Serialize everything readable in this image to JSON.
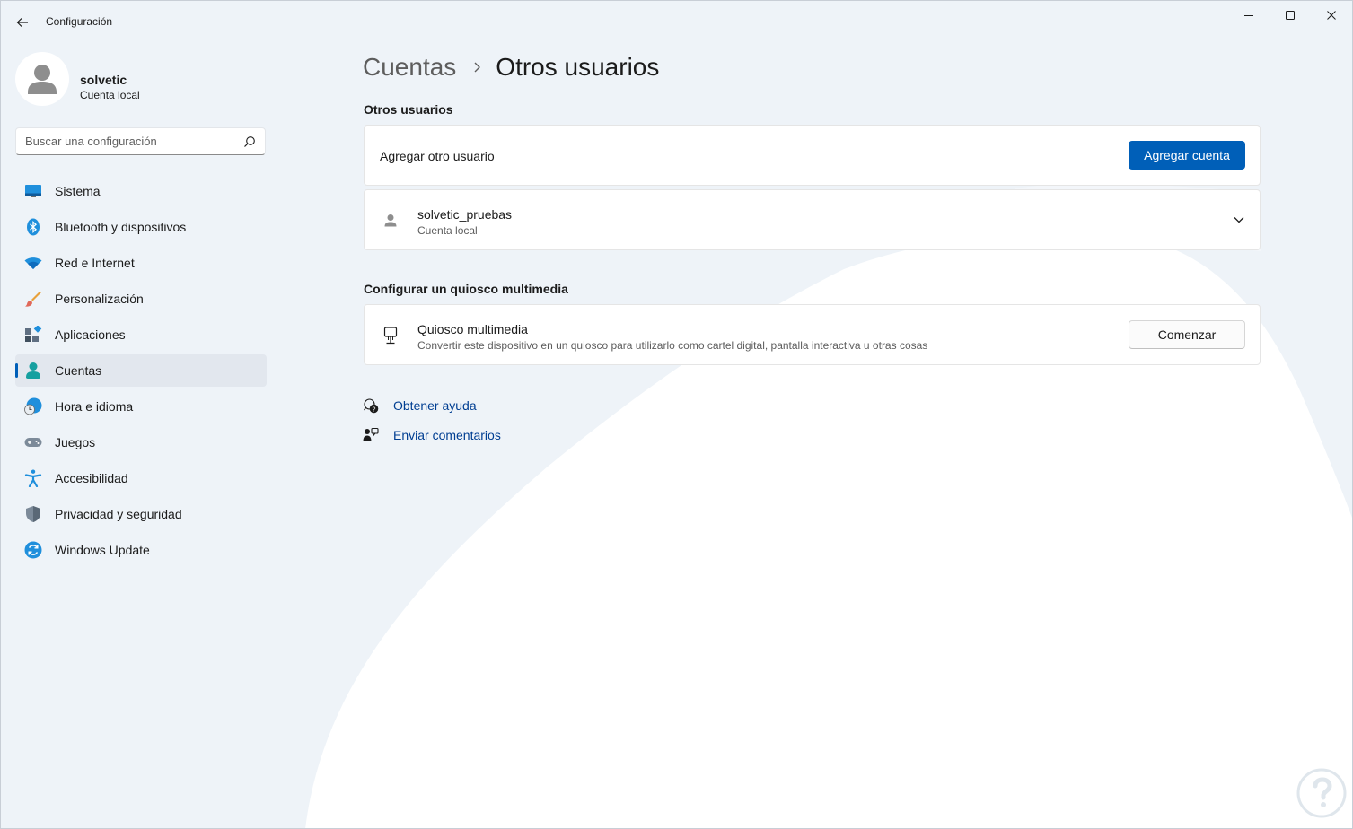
{
  "window": {
    "title": "Configuración",
    "colors": {
      "accent": "#005fb8",
      "link": "#003e92",
      "background": "#eef3f8"
    }
  },
  "user": {
    "name": "solvetic",
    "account_type": "Cuenta local"
  },
  "search": {
    "placeholder": "Buscar una configuración"
  },
  "sidebar": {
    "items": [
      {
        "label": "Sistema",
        "icon": "system-icon"
      },
      {
        "label": "Bluetooth y dispositivos",
        "icon": "bluetooth-icon"
      },
      {
        "label": "Red e Internet",
        "icon": "wifi-icon"
      },
      {
        "label": "Personalización",
        "icon": "brush-icon"
      },
      {
        "label": "Aplicaciones",
        "icon": "apps-icon"
      },
      {
        "label": "Cuentas",
        "icon": "account-icon",
        "selected": true
      },
      {
        "label": "Hora e idioma",
        "icon": "clock-globe-icon"
      },
      {
        "label": "Juegos",
        "icon": "gamepad-icon"
      },
      {
        "label": "Accesibilidad",
        "icon": "accessibility-icon"
      },
      {
        "label": "Privacidad y seguridad",
        "icon": "shield-icon"
      },
      {
        "label": "Windows Update",
        "icon": "update-icon"
      }
    ]
  },
  "breadcrumb": {
    "parent": "Cuentas",
    "current": "Otros usuarios"
  },
  "other_users": {
    "heading": "Otros usuarios",
    "add_label": "Agregar otro usuario",
    "add_button": "Agregar cuenta",
    "entries": [
      {
        "name": "solvetic_pruebas",
        "type": "Cuenta local"
      }
    ]
  },
  "kiosk": {
    "heading": "Configurar un quiosco multimedia",
    "title": "Quiosco multimedia",
    "description": "Convertir este dispositivo en un quiosco para utilizarlo como cartel digital, pantalla interactiva u otras cosas",
    "button": "Comenzar"
  },
  "links": {
    "help": "Obtener ayuda",
    "feedback": "Enviar comentarios"
  }
}
